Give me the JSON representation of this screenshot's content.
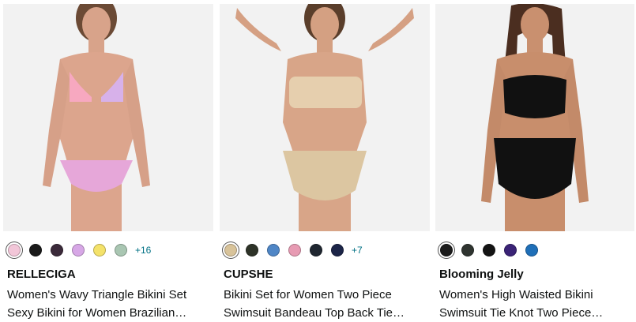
{
  "products": [
    {
      "brand": "RELLECIGA",
      "title_line1": "Women's Wavy Triangle Bikini Set",
      "title_line2": "Sexy Bikini for Women Brazilian…",
      "more_colors": "+16",
      "swatches": [
        "#f2c6d8",
        "#1a1a1a",
        "#3b2a3a",
        "#d7a7e6",
        "#f4e26a",
        "#a9c6b2"
      ],
      "image_colors": {
        "top": "#f7a8c0",
        "bottom": "#e6a7d9"
      }
    },
    {
      "brand": "CUPSHE",
      "title_line1": "Bikini Set for Women Two Piece",
      "title_line2": "Swimsuit Bandeau Top Back Tie…",
      "more_colors": "+7",
      "swatches": [
        "#d8c39a",
        "#2e3328",
        "#4f86c6",
        "#e79bb3",
        "#1f2630",
        "#1c2548"
      ],
      "image_colors": {
        "top": "#e6cfae",
        "bottom": "#dcc6a1"
      }
    },
    {
      "brand": "Blooming Jelly",
      "title_line1": "Women's High Waisted Bikini",
      "title_line2": "Swimsuit Tie Knot Two Piece…",
      "more_colors": "",
      "swatches": [
        "#1c1c1c",
        "#2f3430",
        "#141414",
        "#3a2376",
        "#1f6fb8"
      ],
      "image_colors": {
        "top": "#111111",
        "bottom": "#111111"
      }
    }
  ]
}
